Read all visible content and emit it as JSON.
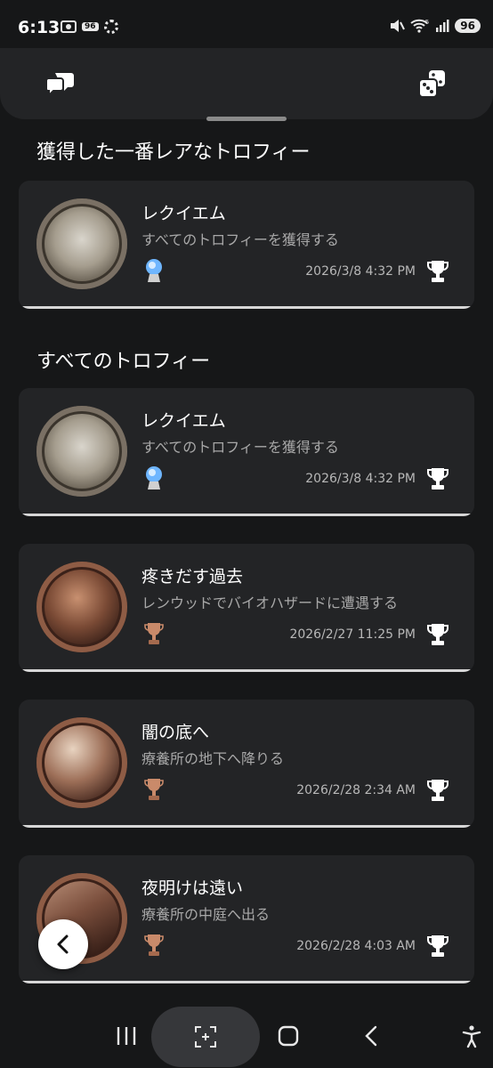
{
  "status_bar": {
    "time": "6:13",
    "mini_badge": "96",
    "battery": "96",
    "wifi_badge": "5"
  },
  "header": {
    "left_icon": "chat-bubbles-icon",
    "right_icon": "dice-icon"
  },
  "sections": {
    "rarest_title": "獲得した一番レアなトロフィー",
    "all_title": "すべてのトロフィー"
  },
  "rarest_trophy": {
    "name": "レクイエム",
    "description": "すべてのトロフィーを獲得する",
    "grade": "platinum",
    "date": "2026/3/8  4:32 PM"
  },
  "trophies": [
    {
      "name": "レクイエム",
      "description": "すべてのトロフィーを獲得する",
      "grade": "platinum",
      "date": "2026/3/8  4:32 PM"
    },
    {
      "name": "疼きだす過去",
      "description": "レンウッドでバイオハザードに遭遇する",
      "grade": "bronze",
      "date": "2026/2/27  11:25 PM"
    },
    {
      "name": "闇の底へ",
      "description": "療養所の地下へ降りる",
      "grade": "bronze",
      "date": "2026/2/28  2:34 AM"
    },
    {
      "name": "夜明けは遠い",
      "description": "療養所の中庭へ出る",
      "grade": "bronze",
      "date": "2026/2/28  4:03 AM"
    }
  ],
  "colors": {
    "background": "#161718",
    "card": "#232426",
    "platinum": "#6fb6ff",
    "bronze": "#c98a6a"
  },
  "nav": {
    "items": [
      "recent-apps-icon",
      "screen-capture-icon",
      "home-icon",
      "back-icon",
      "accessibility-icon"
    ]
  }
}
